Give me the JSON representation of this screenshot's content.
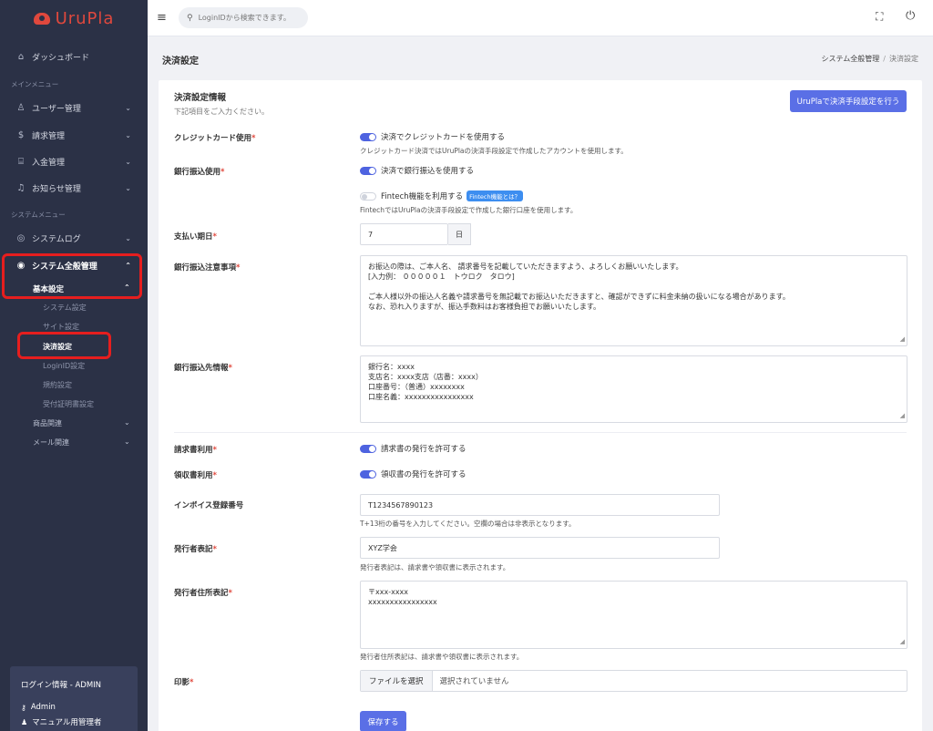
{
  "brand": {
    "name": "UruPla"
  },
  "search": {
    "placeholder": "LoginIDから検索できます。"
  },
  "sidebar": {
    "dashboard": "ダッシュボード",
    "main_menu_label": "メインメニュー",
    "user_mgmt": "ユーザー管理",
    "billing_mgmt": "請求管理",
    "payment_mgmt": "入金管理",
    "notice_mgmt": "お知らせ管理",
    "system_menu_label": "システムメニュー",
    "system_log": "システムログ",
    "system_general": "システム全般管理",
    "basic_settings": "基本設定",
    "sub_items": [
      "システム設定",
      "サイト設定",
      "決済設定",
      "LoginID設定",
      "規約設定",
      "受付証明書設定"
    ],
    "product_related": "商品関連",
    "mail_related": "メール関連",
    "login_info": {
      "title": "ログイン情報 - ADMIN",
      "user": "Admin",
      "role": "マニュアル用管理者"
    }
  },
  "page": {
    "title": "決済設定",
    "breadcrumb": [
      "システム全般管理",
      "決済設定"
    ]
  },
  "card": {
    "title": "決済設定情報",
    "subtitle": "下記項目をご入力ください。",
    "action_button": "UruPlaで決済手段設定を行う"
  },
  "form": {
    "credit_label": "クレジットカード使用",
    "credit_toggle": "決済でクレジットカードを使用する",
    "credit_help": "クレジットカード決済ではUruPlaの決済手段設定で作成したアカウントを使用します。",
    "bank_label": "銀行振込使用",
    "bank_toggle": "決済で銀行振込を使用する",
    "fintech_toggle": "Fintech機能を利用する",
    "fintech_badge": "Fintech機能とは？",
    "fintech_help": "FintechではUruPlaの決済手段設定で作成した銀行口座を使用します。",
    "due_label": "支払い期日",
    "due_value": "7",
    "due_unit": "日",
    "bank_note_label": "銀行振込注意事項",
    "bank_note_lines": [
      "お振込の際は、ご本人名、 請求番号を記載していただきますよう、よろしくお願いいたします。",
      "[入力例： ０００００１　トウロク　タロウ]",
      "",
      "ご本人様以外の振込人名義や請求番号を無記載でお振込いただきますと、確認ができずに料金未納の扱いになる場合があります。",
      "なお、恐れ入りますが、振込手数料はお客様負担でお願いいたします。"
    ],
    "bank_dest_label": "銀行振込先情報",
    "bank_dest_lines": [
      "銀行名：xxxx",
      "支店名：xxxx支店（店番：xxxx）",
      "口座番号：（普通）xxxxxxxx",
      "口座名義：xxxxxxxxxxxxxxxx"
    ],
    "invoice_label": "請求書利用",
    "invoice_toggle": "請求書の発行を許可する",
    "receipt_label": "領収書利用",
    "receipt_toggle": "領収書の発行を許可する",
    "invoice_no_label": "インボイス登録番号",
    "invoice_no_value": "T1234567890123",
    "invoice_no_help": "T+13桁の番号を入力してください。空欄の場合は非表示となります。",
    "issuer_label": "発行者表記",
    "issuer_value": "XYZ学会",
    "issuer_help": "発行者表記は、請求書や領収書に表示されます。",
    "issuer_addr_label": "発行者住所表記",
    "issuer_addr_lines": [
      "〒xxx-xxxx",
      "xxxxxxxxxxxxxxxx"
    ],
    "issuer_addr_help": "発行者住所表記は、請求書や領収書に表示されます。",
    "seal_label": "印影",
    "file_button": "ファイルを選択",
    "file_status": "選択されていません",
    "save_button": "保存する"
  },
  "colors": {
    "accent": "#5a6fe6",
    "sidebar_bg": "#2b3146",
    "brand": "#e0483d",
    "highlight": "#e61e1e"
  }
}
